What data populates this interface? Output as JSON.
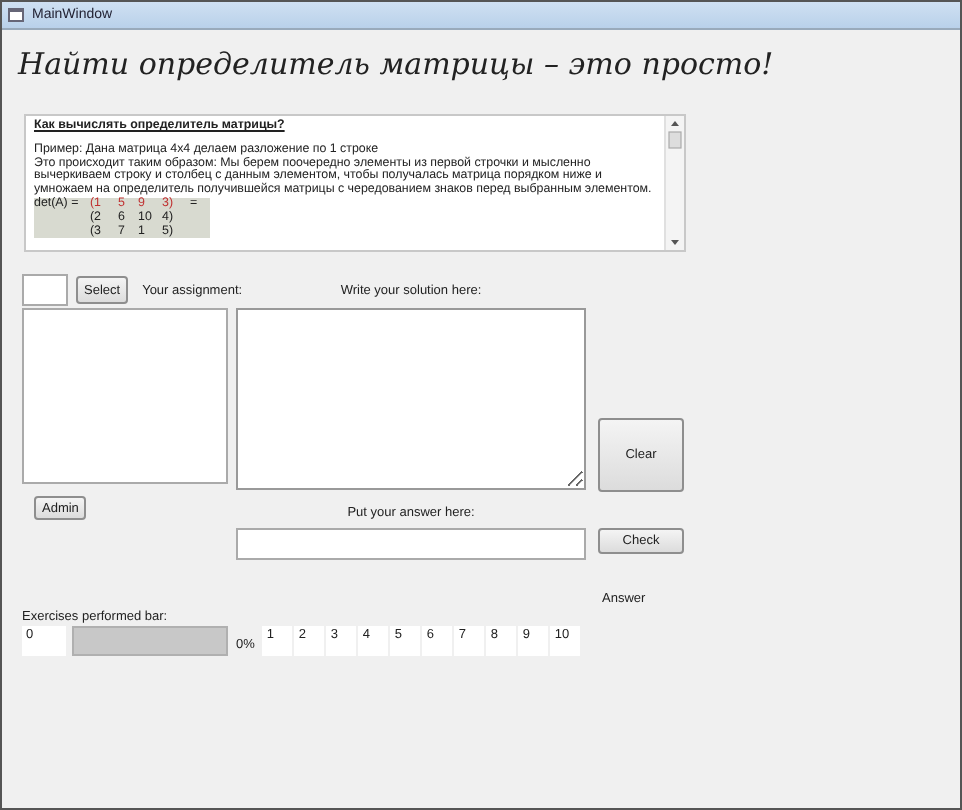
{
  "window": {
    "title": "MainWindow"
  },
  "heading": "Найти определитель матрицы – это просто!",
  "help": {
    "title": "Как вычислять определитель матрицы?",
    "paragraphs": [
      "Пример: Дана матрица 4x4 делаем разложение по 1 строке",
      "Это происходит таким образом: Мы берем поочередно элементы из первой строчки и мысленно вычеркиваем строку и столбец с данным элементом, чтобы получалась матрица порядком ниже и умножаем на определитель получившейся матрицы с чередованием знаков перед выбранным элементом."
    ],
    "matrix": {
      "label": "det(A) =",
      "suffix": "=",
      "rows": [
        {
          "cells": [
            "(1",
            "5",
            "9",
            "3)"
          ],
          "highlighted": true
        },
        {
          "cells": [
            "(2",
            "6",
            "10",
            "4)"
          ],
          "highlighted": false
        },
        {
          "cells": [
            "(3",
            "7",
            "1",
            "5)"
          ],
          "highlighted": false
        }
      ]
    }
  },
  "select_button": "Select",
  "assignment_label": "Your assignment:",
  "solution_label": "Write your solution here:",
  "clear_button": "Clear",
  "admin_button": "Admin",
  "answer_label": "Put your answer here:",
  "check_button": "Check",
  "answer_result": "Answer",
  "progress": {
    "label": "Exercises performed bar:",
    "count": "0",
    "level": 0,
    "percent": "0%",
    "steps": [
      "1",
      "2",
      "3",
      "4",
      "5",
      "6",
      "7",
      "8",
      "9",
      "10"
    ]
  }
}
